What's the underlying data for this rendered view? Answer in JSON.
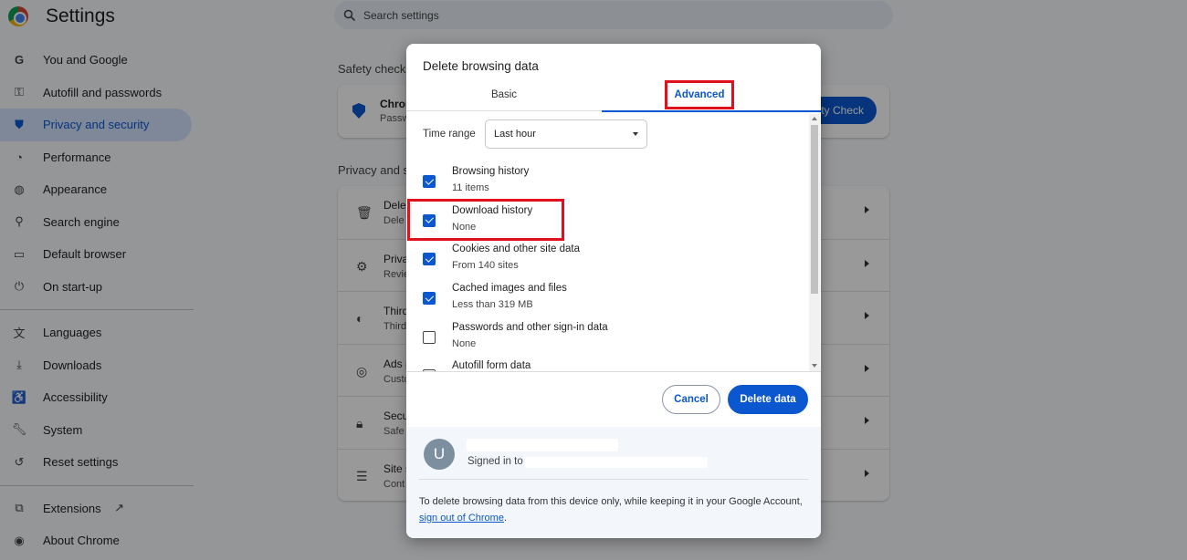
{
  "window": {
    "title": "Settings"
  },
  "search": {
    "placeholder": "Search settings"
  },
  "sidebar": {
    "items": [
      {
        "label": "You and Google",
        "icon": "google-icon"
      },
      {
        "label": "Autofill and passwords",
        "icon": "key-icon"
      },
      {
        "label": "Privacy and security",
        "icon": "shield-icon",
        "active": true
      },
      {
        "label": "Performance",
        "icon": "speedometer-icon"
      },
      {
        "label": "Appearance",
        "icon": "palette-icon"
      },
      {
        "label": "Search engine",
        "icon": "search-icon"
      },
      {
        "label": "Default browser",
        "icon": "browser-icon"
      },
      {
        "label": "On start-up",
        "icon": "power-icon"
      },
      {
        "label": "Languages",
        "icon": "translate-icon"
      },
      {
        "label": "Downloads",
        "icon": "download-icon"
      },
      {
        "label": "Accessibility",
        "icon": "accessibility-icon"
      },
      {
        "label": "System",
        "icon": "wrench-icon"
      },
      {
        "label": "Reset settings",
        "icon": "reset-icon"
      },
      {
        "label": "Extensions",
        "icon": "puzzle-icon"
      },
      {
        "label": "About Chrome",
        "icon": "chrome-icon"
      }
    ]
  },
  "main": {
    "safety_title": "Safety check",
    "safety_card": {
      "title": "Chrom",
      "subtitle": "Passw",
      "button": "ety Check"
    },
    "privacy_title": "Privacy and s",
    "privacy_rows": [
      {
        "title": "Dele",
        "subtitle": "Dele"
      },
      {
        "title": "Priva",
        "subtitle": "Revie"
      },
      {
        "title": "Third",
        "subtitle": "Third"
      },
      {
        "title": "Ads p",
        "subtitle": "Custo"
      },
      {
        "title": "Secu",
        "subtitle": "Safe"
      },
      {
        "title": "Site s",
        "subtitle": "Cont"
      }
    ]
  },
  "dialog": {
    "title": "Delete browsing data",
    "tabs": {
      "basic": "Basic",
      "advanced": "Advanced",
      "selected": "advanced"
    },
    "time_range": {
      "label": "Time range",
      "value": "Last hour"
    },
    "items": [
      {
        "name": "Browsing history",
        "sub": "11 items",
        "checked": true
      },
      {
        "name": "Download history",
        "sub": "None",
        "checked": true
      },
      {
        "name": "Cookies and other site data",
        "sub": "From 140 sites",
        "checked": true
      },
      {
        "name": "Cached images and files",
        "sub": "Less than 319 MB",
        "checked": true
      },
      {
        "name": "Passwords and other sign-in data",
        "sub": "None",
        "checked": false
      },
      {
        "name": "Autofill form data",
        "sub": "",
        "checked": false
      }
    ],
    "buttons": {
      "cancel": "Cancel",
      "delete": "Delete data"
    },
    "account": {
      "avatar_letter": "U",
      "signed_in_prefix": "Signed in to"
    },
    "footer": {
      "text_before": "To delete browsing data from this device only, while keeping it in your Google Account, ",
      "link": "sign out of Chrome",
      "text_after": "."
    }
  },
  "colors": {
    "accent": "#0b57d0",
    "highlight": "#e0101f",
    "scrim": "rgba(0,0,0,0.40)"
  }
}
